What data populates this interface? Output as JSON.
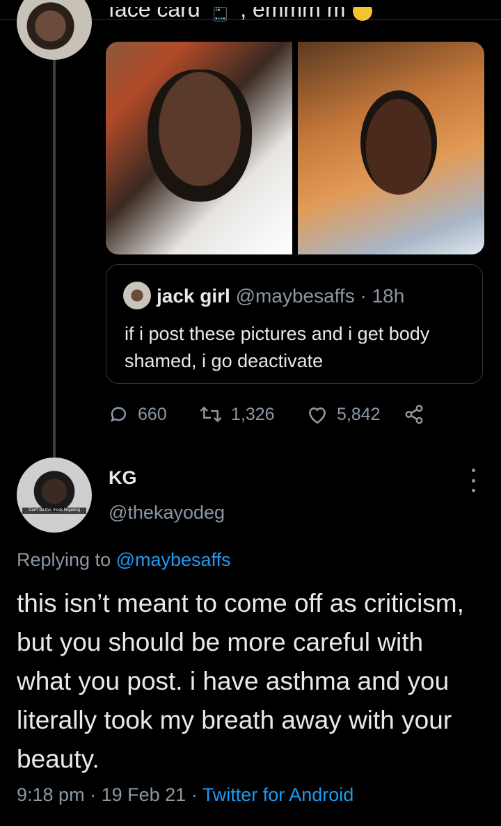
{
  "top_tweet": {
    "text_fragment": "face card",
    "text_fragment_2": ", emmm m"
  },
  "quoted_tweet": {
    "name": "jack girl",
    "handle": "@maybesaffs",
    "separator": " · ",
    "time": "18h",
    "text": "if i post these pictures and i get body shamed, i go deactivate"
  },
  "actions": {
    "replies": "660",
    "retweets": "1,326",
    "likes": "5,842"
  },
  "reply": {
    "name": "KG",
    "handle": "@thekayodeg",
    "avatar_caption": "Can't do this mock fingering",
    "replying_prefix": "Replying to ",
    "replying_mention": "@maybesaffs",
    "text": "this isn’t meant to come off as criticism, but you should be more careful with what you post. i have asthma and you literally took my breath away with your beauty.",
    "time": "9:18 pm",
    "date": "19 Feb 21",
    "source": "Twitter for Android"
  },
  "colors": {
    "background": "#000000",
    "text": "#e7e9ea",
    "muted": "#8b98a5",
    "accent": "#1d9bf0",
    "border": "#333639"
  }
}
